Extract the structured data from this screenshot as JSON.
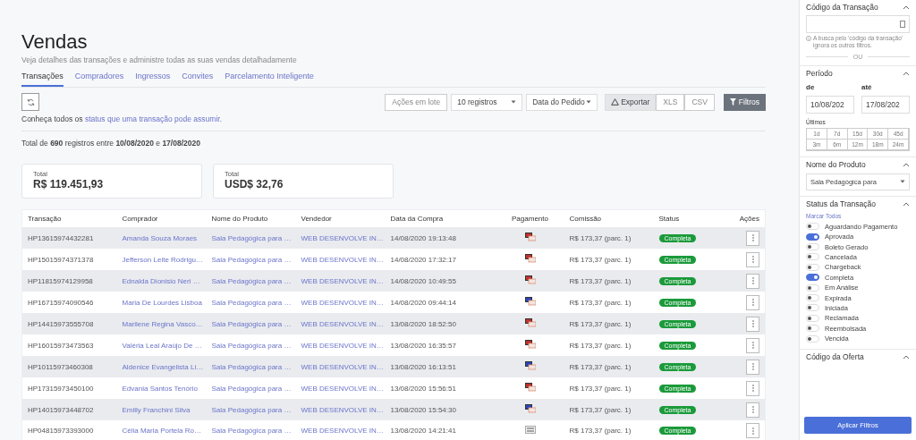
{
  "header": {
    "title": "Vendas",
    "subtitle": "Veja detalhes das transações e administre todas as suas vendas detalhadamente"
  },
  "tabs": [
    {
      "label": "Transações",
      "selected": true
    },
    {
      "label": "Compradores",
      "selected": false
    },
    {
      "label": "Ingressos",
      "selected": false
    },
    {
      "label": "Convites",
      "selected": false
    },
    {
      "label": "Parcelamento Inteligente",
      "selected": false
    }
  ],
  "toolbar": {
    "batch_button": "Ações em lote",
    "page_size": "10 registros",
    "date_type": "Data do Pedido",
    "export_label": "Exportar",
    "export_formats": [
      "XLS",
      "CSV"
    ],
    "filters_button": "Filtros"
  },
  "status_info": {
    "text": "Conheça todos os",
    "link": "status que uma transação pode assumir."
  },
  "summary": "Total de **690** registros entre **10/08/2020** e **17/08/2020**",
  "totals": [
    {
      "label": "Total",
      "value": "R$ 119.451,93"
    },
    {
      "label": "Total",
      "value": "USD$ 32,76"
    }
  ],
  "table": {
    "columns": [
      "Transação",
      "Comprador",
      "Nome do Produto",
      "Vendedor",
      "Data da Compra",
      "Pagamento",
      "Comissão",
      "Status",
      "Ações"
    ],
    "rows": [
      {
        "transaction": "HP13615974432281",
        "buyer": "Amanda Souza Moraes",
        "product": "Sala Pedagógica para …",
        "seller": "WEB DESENVOLVE IN…",
        "date": "14/08/2020 19:13:48",
        "payment": {
          "kind": "redcard"
        },
        "commission": "R$ 173,37 (parc. 1)",
        "status": "Completa"
      },
      {
        "transaction": "HP15015974371378",
        "buyer": "Jefferson Leite Rodrigu…",
        "product": "Sala Pedagógica para …",
        "seller": "WEB DESENVOLVE IN…",
        "date": "14/08/2020 17:32:17",
        "payment": {
          "kind": "redcard"
        },
        "commission": "R$ 173,37 (parc. 1)",
        "status": "Completa"
      },
      {
        "transaction": "HP11815974129958",
        "buyer": "Ednalda Dionisio Neri …",
        "product": "Sala Pedagógica para …",
        "seller": "WEB DESENVOLVE IN…",
        "date": "14/08/2020 10:49:55",
        "payment": {
          "kind": "redcard"
        },
        "commission": "R$ 173,37 (parc. 1)",
        "status": "Completa"
      },
      {
        "transaction": "HP16715974090546",
        "buyer": "Maria De Lourdes Lisboa",
        "product": "Sala Pedagógica para …",
        "seller": "WEB DESENVOLVE IN…",
        "date": "14/08/2020 09:44:14",
        "payment": {
          "kind": "bluecard"
        },
        "commission": "R$ 173,37 (parc. 1)",
        "status": "Completa"
      },
      {
        "transaction": "HP14415973555708",
        "buyer": "Marilene Regina Vasco…",
        "product": "Sala Pedagógica para …",
        "seller": "WEB DESENVOLVE IN…",
        "date": "13/08/2020 18:52:50",
        "payment": {
          "kind": "redcard"
        },
        "commission": "R$ 173,37 (parc. 1)",
        "status": "Completa"
      },
      {
        "transaction": "HP16015973473563",
        "buyer": "Valéria Leal Araújo De …",
        "product": "Sala Pedagógica para …",
        "seller": "WEB DESENVOLVE IN…",
        "date": "13/08/2020 16:35:57",
        "payment": {
          "kind": "redcard"
        },
        "commission": "R$ 173,37 (parc. 1)",
        "status": "Completa"
      },
      {
        "transaction": "HP10115973460308",
        "buyer": "Aldenice Evangelista Li…",
        "product": "Sala Pedagógica para …",
        "seller": "WEB DESENVOLVE IN…",
        "date": "13/08/2020 16:13:51",
        "payment": {
          "kind": "bluecard"
        },
        "commission": "R$ 173,37 (parc. 1)",
        "status": "Completa"
      },
      {
        "transaction": "HP17315973450100",
        "buyer": "Edvania Santos Tenório",
        "product": "Sala Pedagógica para …",
        "seller": "WEB DESENVOLVE IN…",
        "date": "13/08/2020 15:56:51",
        "payment": {
          "kind": "redcard"
        },
        "commission": "R$ 173,37 (parc. 1)",
        "status": "Completa"
      },
      {
        "transaction": "HP14015973448702",
        "buyer": "Emilly Franchini Silva",
        "product": "Sala Pedagógica para …",
        "seller": "WEB DESENVOLVE IN…",
        "date": "13/08/2020 15:54:30",
        "payment": {
          "kind": "bluecard"
        },
        "commission": "R$ 173,37 (parc. 1)",
        "status": "Completa"
      },
      {
        "transaction": "HP04815973393000",
        "buyer": "Célia Maria Portela Ro…",
        "product": "Sala Pedagógica para …",
        "seller": "WEB DESENVOLVE IN…",
        "date": "13/08/2020 14:21:41",
        "payment": {
          "kind": "boleto"
        },
        "commission": "R$ 173,37 (parc. 1)",
        "status": "Completa"
      }
    ]
  },
  "filters": {
    "transaction_code": {
      "title": "Código da Transação",
      "hint": "A busca pelo 'código da transação' ignora os outros filtros.",
      "separator": "OU"
    },
    "period": {
      "title": "Período",
      "from_label": "de",
      "to_label": "até",
      "from_value": "10/08/202",
      "to_value": "17/08/202",
      "recent_label": "Últimos",
      "ranges": [
        "1d",
        "7d",
        "15d",
        "30d",
        "45d",
        "3m",
        "6m",
        "12m",
        "18m",
        "24m"
      ]
    },
    "product": {
      "title": "Nome do Produto",
      "value": "Sala Pedagógica para"
    },
    "status": {
      "title": "Status da Transação",
      "select_all": "Marcar Todos",
      "options": [
        {
          "label": "Aguardando Pagamento",
          "on": false
        },
        {
          "label": "Aprovada",
          "on": true
        },
        {
          "label": "Boleto Gerado",
          "on": false
        },
        {
          "label": "Cancelada",
          "on": false
        },
        {
          "label": "Chargeback",
          "on": false
        },
        {
          "label": "Completa",
          "on": true
        },
        {
          "label": "Em Análise",
          "on": false
        },
        {
          "label": "Expirada",
          "on": false
        },
        {
          "label": "Iniciada",
          "on": false
        },
        {
          "label": "Reclamada",
          "on": false
        },
        {
          "label": "Reembolsada",
          "on": false
        },
        {
          "label": "Vencida",
          "on": false
        }
      ]
    },
    "offer": {
      "title": "Código da Oferta"
    },
    "apply_button": "Aplicar Filtros"
  }
}
